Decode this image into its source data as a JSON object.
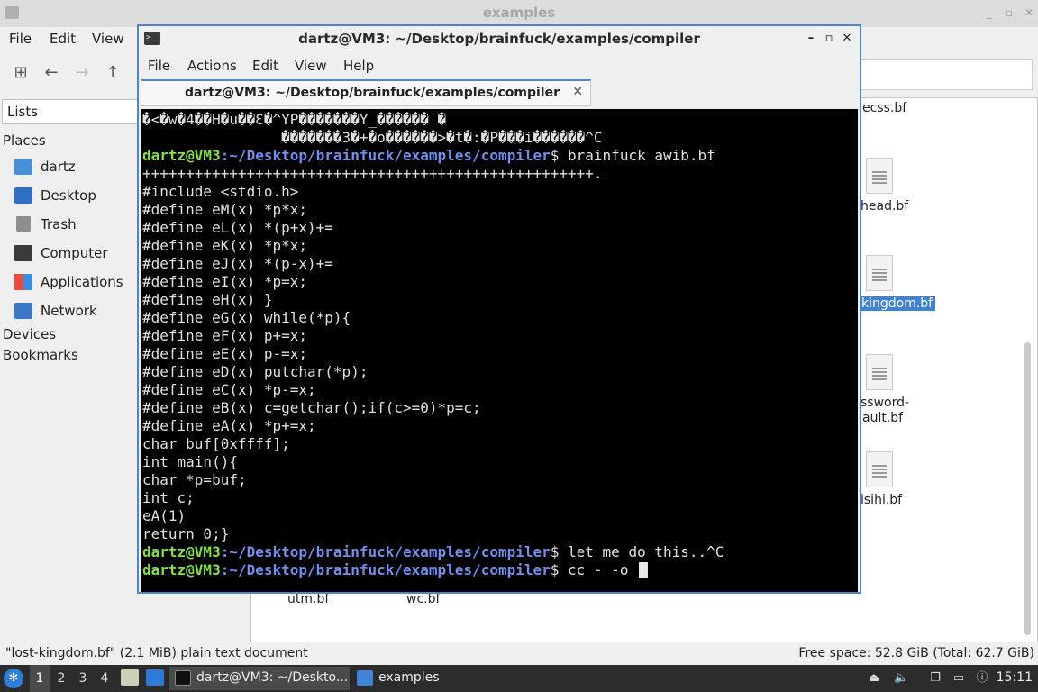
{
  "desktop": {
    "file_manager": {
      "title": "examples",
      "menu": [
        "File",
        "Edit",
        "View"
      ],
      "lists_label": "Lists",
      "places_heading": "Places",
      "places": [
        {
          "label": "dartz",
          "icon": "home-folder-icon"
        },
        {
          "label": "Desktop",
          "icon": "desktop-icon"
        },
        {
          "label": "Trash",
          "icon": "trash-icon"
        },
        {
          "label": "Computer",
          "icon": "computer-icon"
        },
        {
          "label": "Applications",
          "icon": "applications-icon"
        },
        {
          "label": "Network",
          "icon": "network-icon"
        }
      ],
      "devices_heading": "Devices",
      "bookmarks_heading": "Bookmarks",
      "files": {
        "ecss": "ecss.bf",
        "head": "head.bf",
        "kingdom": "kingdom.bf",
        "password_line1": "ssword-",
        "password_line2": "ault.bf",
        "isihi": "isihi.bf",
        "utm": "utm.bf",
        "wc": "wc.bf"
      },
      "status_left": "\"lost-kingdom.bf\" (2.1 MiB) plain text document",
      "status_right": "Free space: 52.8 GiB (Total: 62.7 GiB)"
    },
    "terminal": {
      "title": "dartz@VM3: ~/Desktop/brainfuck/examples/compiler",
      "menu": [
        "File",
        "Actions",
        "Edit",
        "View",
        "Help"
      ],
      "tab_label": "dartz@VM3: ~/Desktop/brainfuck/examples/compiler",
      "garbage_line1": "�<�w�4��H�u��Ɛ�^YP�������Y_������ �",
      "garbage_line2": "                �������3�+�o������>�t�:�P���i������^C",
      "prompt_user": "dartz@VM3",
      "prompt_path": ":~/Desktop/brainfuck/examples/compiler",
      "cmd1": "$ brainfuck awib.bf",
      "output": [
        "++++++++++++++++++++++++++++++++++++++++++++++++++++.",
        "#include <stdio.h>",
        "#define eM(x) *p*x;",
        "#define eL(x) *(p+x)+=",
        "#define eK(x) *p*x;",
        "#define eJ(x) *(p-x)+=",
        "#define eI(x) *p=x;",
        "#define eH(x) }",
        "#define eG(x) while(*p){",
        "#define eF(x) p+=x;",
        "#define eE(x) p-=x;",
        "#define eD(x) putchar(*p);",
        "#define eC(x) *p-=x;",
        "#define eB(x) c=getchar();if(c>=0)*p=c;",
        "#define eA(x) *p+=x;",
        "char buf[0xffff];",
        "int main(){",
        "char *p=buf;",
        "int c;",
        "eA(1)",
        "return 0;}"
      ],
      "cmd2": "$ let me do this..^C",
      "cmd3": "$ cc - -o "
    },
    "taskbar": {
      "workspaces": [
        "1",
        "2",
        "3",
        "4"
      ],
      "active_workspace": "1",
      "tasks": [
        {
          "label": "dartz@VM3: ~/Deskto...",
          "icon": "terminal-icon"
        },
        {
          "label": "examples",
          "icon": "folder-icon"
        }
      ],
      "clock": "15:11"
    }
  }
}
